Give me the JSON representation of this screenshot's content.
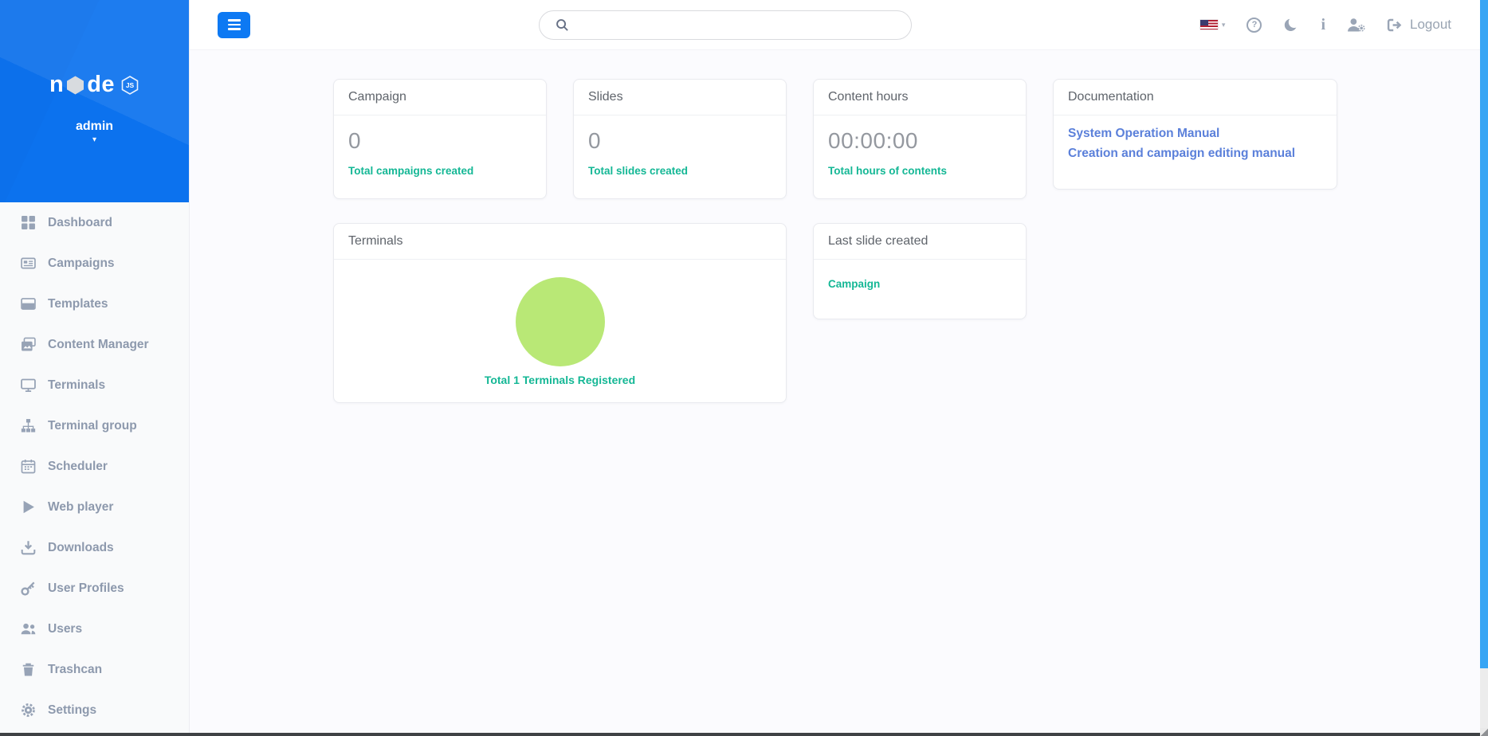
{
  "app": {
    "logo": {
      "part1": "n",
      "part2": "de",
      "badge": "JS"
    }
  },
  "icons": {
    "caret_down": "▾",
    "help_glyph": "?",
    "info_glyph": "i"
  },
  "sidebar": {
    "user": "admin",
    "items": [
      {
        "label": "Dashboard"
      },
      {
        "label": "Campaigns"
      },
      {
        "label": "Templates"
      },
      {
        "label": "Content Manager"
      },
      {
        "label": "Terminals"
      },
      {
        "label": "Terminal group"
      },
      {
        "label": "Scheduler"
      },
      {
        "label": "Web player"
      },
      {
        "label": "Downloads"
      },
      {
        "label": "User Profiles"
      },
      {
        "label": "Users"
      },
      {
        "label": "Trashcan"
      },
      {
        "label": "Settings"
      }
    ]
  },
  "topbar": {
    "search_placeholder": "",
    "logout_label": "Logout"
  },
  "cards": {
    "campaign": {
      "title": "Campaign",
      "value": "0",
      "caption": "Total campaigns created"
    },
    "slides": {
      "title": "Slides",
      "value": "0",
      "caption": "Total slides created"
    },
    "content_hours": {
      "title": "Content hours",
      "value": "00:00:00",
      "caption": "Total hours of contents"
    },
    "documentation": {
      "title": "Documentation",
      "links": [
        {
          "label": "System Operation Manual"
        },
        {
          "label": "Creation and campaign editing manual"
        }
      ]
    },
    "terminals": {
      "title": "Terminals",
      "caption": "Total 1 Terminals Registered",
      "registered_count": 1
    },
    "last_slide": {
      "title": "Last slide created",
      "link_label": "Campaign"
    }
  },
  "colors": {
    "accent_blue": "#0d78f3",
    "sidebar_header_blue": "#0c72ee",
    "teal": "#14b795",
    "link_blue": "#5b80da",
    "chart_green": "#b9e876",
    "scrollbar_blue": "#38a5f4"
  }
}
